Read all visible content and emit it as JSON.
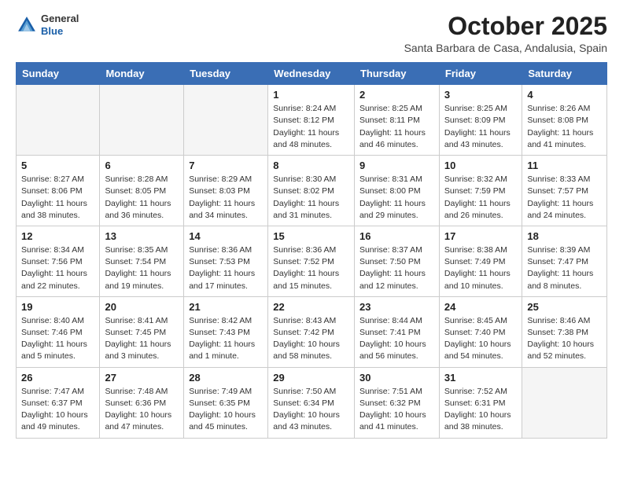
{
  "logo": {
    "general": "General",
    "blue": "Blue"
  },
  "header": {
    "month": "October 2025",
    "location": "Santa Barbara de Casa, Andalusia, Spain"
  },
  "weekdays": [
    "Sunday",
    "Monday",
    "Tuesday",
    "Wednesday",
    "Thursday",
    "Friday",
    "Saturday"
  ],
  "weeks": [
    [
      {
        "day": "",
        "info": ""
      },
      {
        "day": "",
        "info": ""
      },
      {
        "day": "",
        "info": ""
      },
      {
        "day": "1",
        "info": "Sunrise: 8:24 AM\nSunset: 8:12 PM\nDaylight: 11 hours and 48 minutes."
      },
      {
        "day": "2",
        "info": "Sunrise: 8:25 AM\nSunset: 8:11 PM\nDaylight: 11 hours and 46 minutes."
      },
      {
        "day": "3",
        "info": "Sunrise: 8:25 AM\nSunset: 8:09 PM\nDaylight: 11 hours and 43 minutes."
      },
      {
        "day": "4",
        "info": "Sunrise: 8:26 AM\nSunset: 8:08 PM\nDaylight: 11 hours and 41 minutes."
      }
    ],
    [
      {
        "day": "5",
        "info": "Sunrise: 8:27 AM\nSunset: 8:06 PM\nDaylight: 11 hours and 38 minutes."
      },
      {
        "day": "6",
        "info": "Sunrise: 8:28 AM\nSunset: 8:05 PM\nDaylight: 11 hours and 36 minutes."
      },
      {
        "day": "7",
        "info": "Sunrise: 8:29 AM\nSunset: 8:03 PM\nDaylight: 11 hours and 34 minutes."
      },
      {
        "day": "8",
        "info": "Sunrise: 8:30 AM\nSunset: 8:02 PM\nDaylight: 11 hours and 31 minutes."
      },
      {
        "day": "9",
        "info": "Sunrise: 8:31 AM\nSunset: 8:00 PM\nDaylight: 11 hours and 29 minutes."
      },
      {
        "day": "10",
        "info": "Sunrise: 8:32 AM\nSunset: 7:59 PM\nDaylight: 11 hours and 26 minutes."
      },
      {
        "day": "11",
        "info": "Sunrise: 8:33 AM\nSunset: 7:57 PM\nDaylight: 11 hours and 24 minutes."
      }
    ],
    [
      {
        "day": "12",
        "info": "Sunrise: 8:34 AM\nSunset: 7:56 PM\nDaylight: 11 hours and 22 minutes."
      },
      {
        "day": "13",
        "info": "Sunrise: 8:35 AM\nSunset: 7:54 PM\nDaylight: 11 hours and 19 minutes."
      },
      {
        "day": "14",
        "info": "Sunrise: 8:36 AM\nSunset: 7:53 PM\nDaylight: 11 hours and 17 minutes."
      },
      {
        "day": "15",
        "info": "Sunrise: 8:36 AM\nSunset: 7:52 PM\nDaylight: 11 hours and 15 minutes."
      },
      {
        "day": "16",
        "info": "Sunrise: 8:37 AM\nSunset: 7:50 PM\nDaylight: 11 hours and 12 minutes."
      },
      {
        "day": "17",
        "info": "Sunrise: 8:38 AM\nSunset: 7:49 PM\nDaylight: 11 hours and 10 minutes."
      },
      {
        "day": "18",
        "info": "Sunrise: 8:39 AM\nSunset: 7:47 PM\nDaylight: 11 hours and 8 minutes."
      }
    ],
    [
      {
        "day": "19",
        "info": "Sunrise: 8:40 AM\nSunset: 7:46 PM\nDaylight: 11 hours and 5 minutes."
      },
      {
        "day": "20",
        "info": "Sunrise: 8:41 AM\nSunset: 7:45 PM\nDaylight: 11 hours and 3 minutes."
      },
      {
        "day": "21",
        "info": "Sunrise: 8:42 AM\nSunset: 7:43 PM\nDaylight: 11 hours and 1 minute."
      },
      {
        "day": "22",
        "info": "Sunrise: 8:43 AM\nSunset: 7:42 PM\nDaylight: 10 hours and 58 minutes."
      },
      {
        "day": "23",
        "info": "Sunrise: 8:44 AM\nSunset: 7:41 PM\nDaylight: 10 hours and 56 minutes."
      },
      {
        "day": "24",
        "info": "Sunrise: 8:45 AM\nSunset: 7:40 PM\nDaylight: 10 hours and 54 minutes."
      },
      {
        "day": "25",
        "info": "Sunrise: 8:46 AM\nSunset: 7:38 PM\nDaylight: 10 hours and 52 minutes."
      }
    ],
    [
      {
        "day": "26",
        "info": "Sunrise: 7:47 AM\nSunset: 6:37 PM\nDaylight: 10 hours and 49 minutes."
      },
      {
        "day": "27",
        "info": "Sunrise: 7:48 AM\nSunset: 6:36 PM\nDaylight: 10 hours and 47 minutes."
      },
      {
        "day": "28",
        "info": "Sunrise: 7:49 AM\nSunset: 6:35 PM\nDaylight: 10 hours and 45 minutes."
      },
      {
        "day": "29",
        "info": "Sunrise: 7:50 AM\nSunset: 6:34 PM\nDaylight: 10 hours and 43 minutes."
      },
      {
        "day": "30",
        "info": "Sunrise: 7:51 AM\nSunset: 6:32 PM\nDaylight: 10 hours and 41 minutes."
      },
      {
        "day": "31",
        "info": "Sunrise: 7:52 AM\nSunset: 6:31 PM\nDaylight: 10 hours and 38 minutes."
      },
      {
        "day": "",
        "info": ""
      }
    ]
  ]
}
